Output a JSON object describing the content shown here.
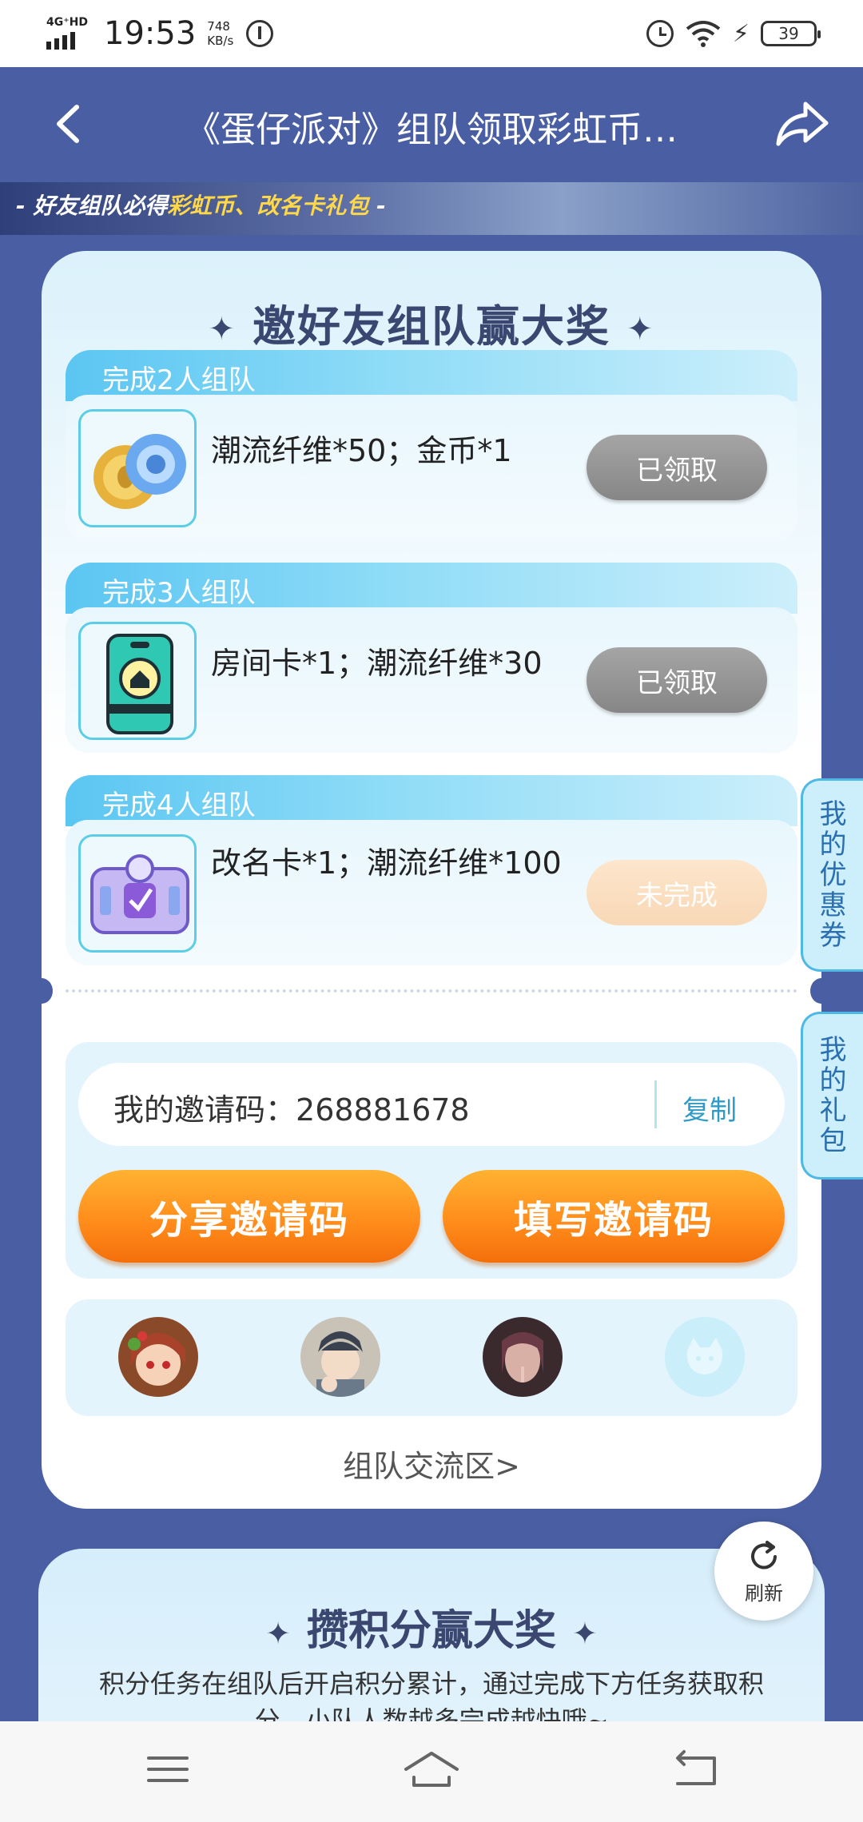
{
  "status_bar": {
    "network": "4G⁺HD",
    "time": "19:53",
    "speed_value": "748",
    "speed_unit": "KB/s",
    "battery": "39",
    "icons": [
      "signal-icon",
      "data-saver-icon",
      "alarm-icon",
      "wifi-icon",
      "charging-icon",
      "battery-icon"
    ]
  },
  "header": {
    "title": "《蛋仔派对》组队领取彩虹币…",
    "back_icon": "back-arrow-icon",
    "share_icon": "share-icon"
  },
  "banner": {
    "prefix": "- 好友组队必得",
    "highlight": "彩虹币、改名卡礼包",
    "suffix": " -"
  },
  "team_rewards": {
    "title": "邀好友组队赢大奖",
    "title_star": "✦",
    "tiers": [
      {
        "tab": "完成2人组队",
        "reward": "潮流纤维*50；金币*1",
        "button": "已领取",
        "state": "claimed",
        "icon": "coin-fiber-icon"
      },
      {
        "tab": "完成3人组队",
        "reward": "房间卡*1；潮流纤维*30",
        "button": "已领取",
        "state": "claimed",
        "icon": "room-card-icon"
      },
      {
        "tab": "完成4人组队",
        "reward": "改名卡*1；潮流纤维*100",
        "button": "未完成",
        "state": "incomplete",
        "icon": "rename-card-icon"
      }
    ]
  },
  "invite": {
    "code_label": "我的邀请码：",
    "code": "268881678",
    "copy_label": "复制",
    "share_button": "分享邀请码",
    "fill_button": "填写邀请码"
  },
  "team_members": [
    {
      "name": "member-1-avatar",
      "color": "#e8a07a"
    },
    {
      "name": "member-2-avatar",
      "color": "#b7a99a"
    },
    {
      "name": "member-3-avatar",
      "color": "#6b4a4a"
    },
    {
      "name": "empty-slot-avatar",
      "color": "#cbeefb"
    }
  ],
  "team_link": "组队交流区>",
  "side_tabs": {
    "coupons": [
      "我",
      "的",
      "优",
      "惠",
      "券"
    ],
    "gifts": [
      "我",
      "的",
      "礼",
      "包"
    ]
  },
  "points": {
    "title": "攒积分赢大奖",
    "description": "积分任务在组队后开启积分累计，通过完成下方任务获取积分，小队人数越多完成越快哦~"
  },
  "refresh_label": "刷新",
  "colors": {
    "header_bg": "#4a5fa3",
    "accent_orange": "#ff8a1a",
    "tab_blue": "#5bc6f2",
    "claimed_gray": "#969696"
  }
}
